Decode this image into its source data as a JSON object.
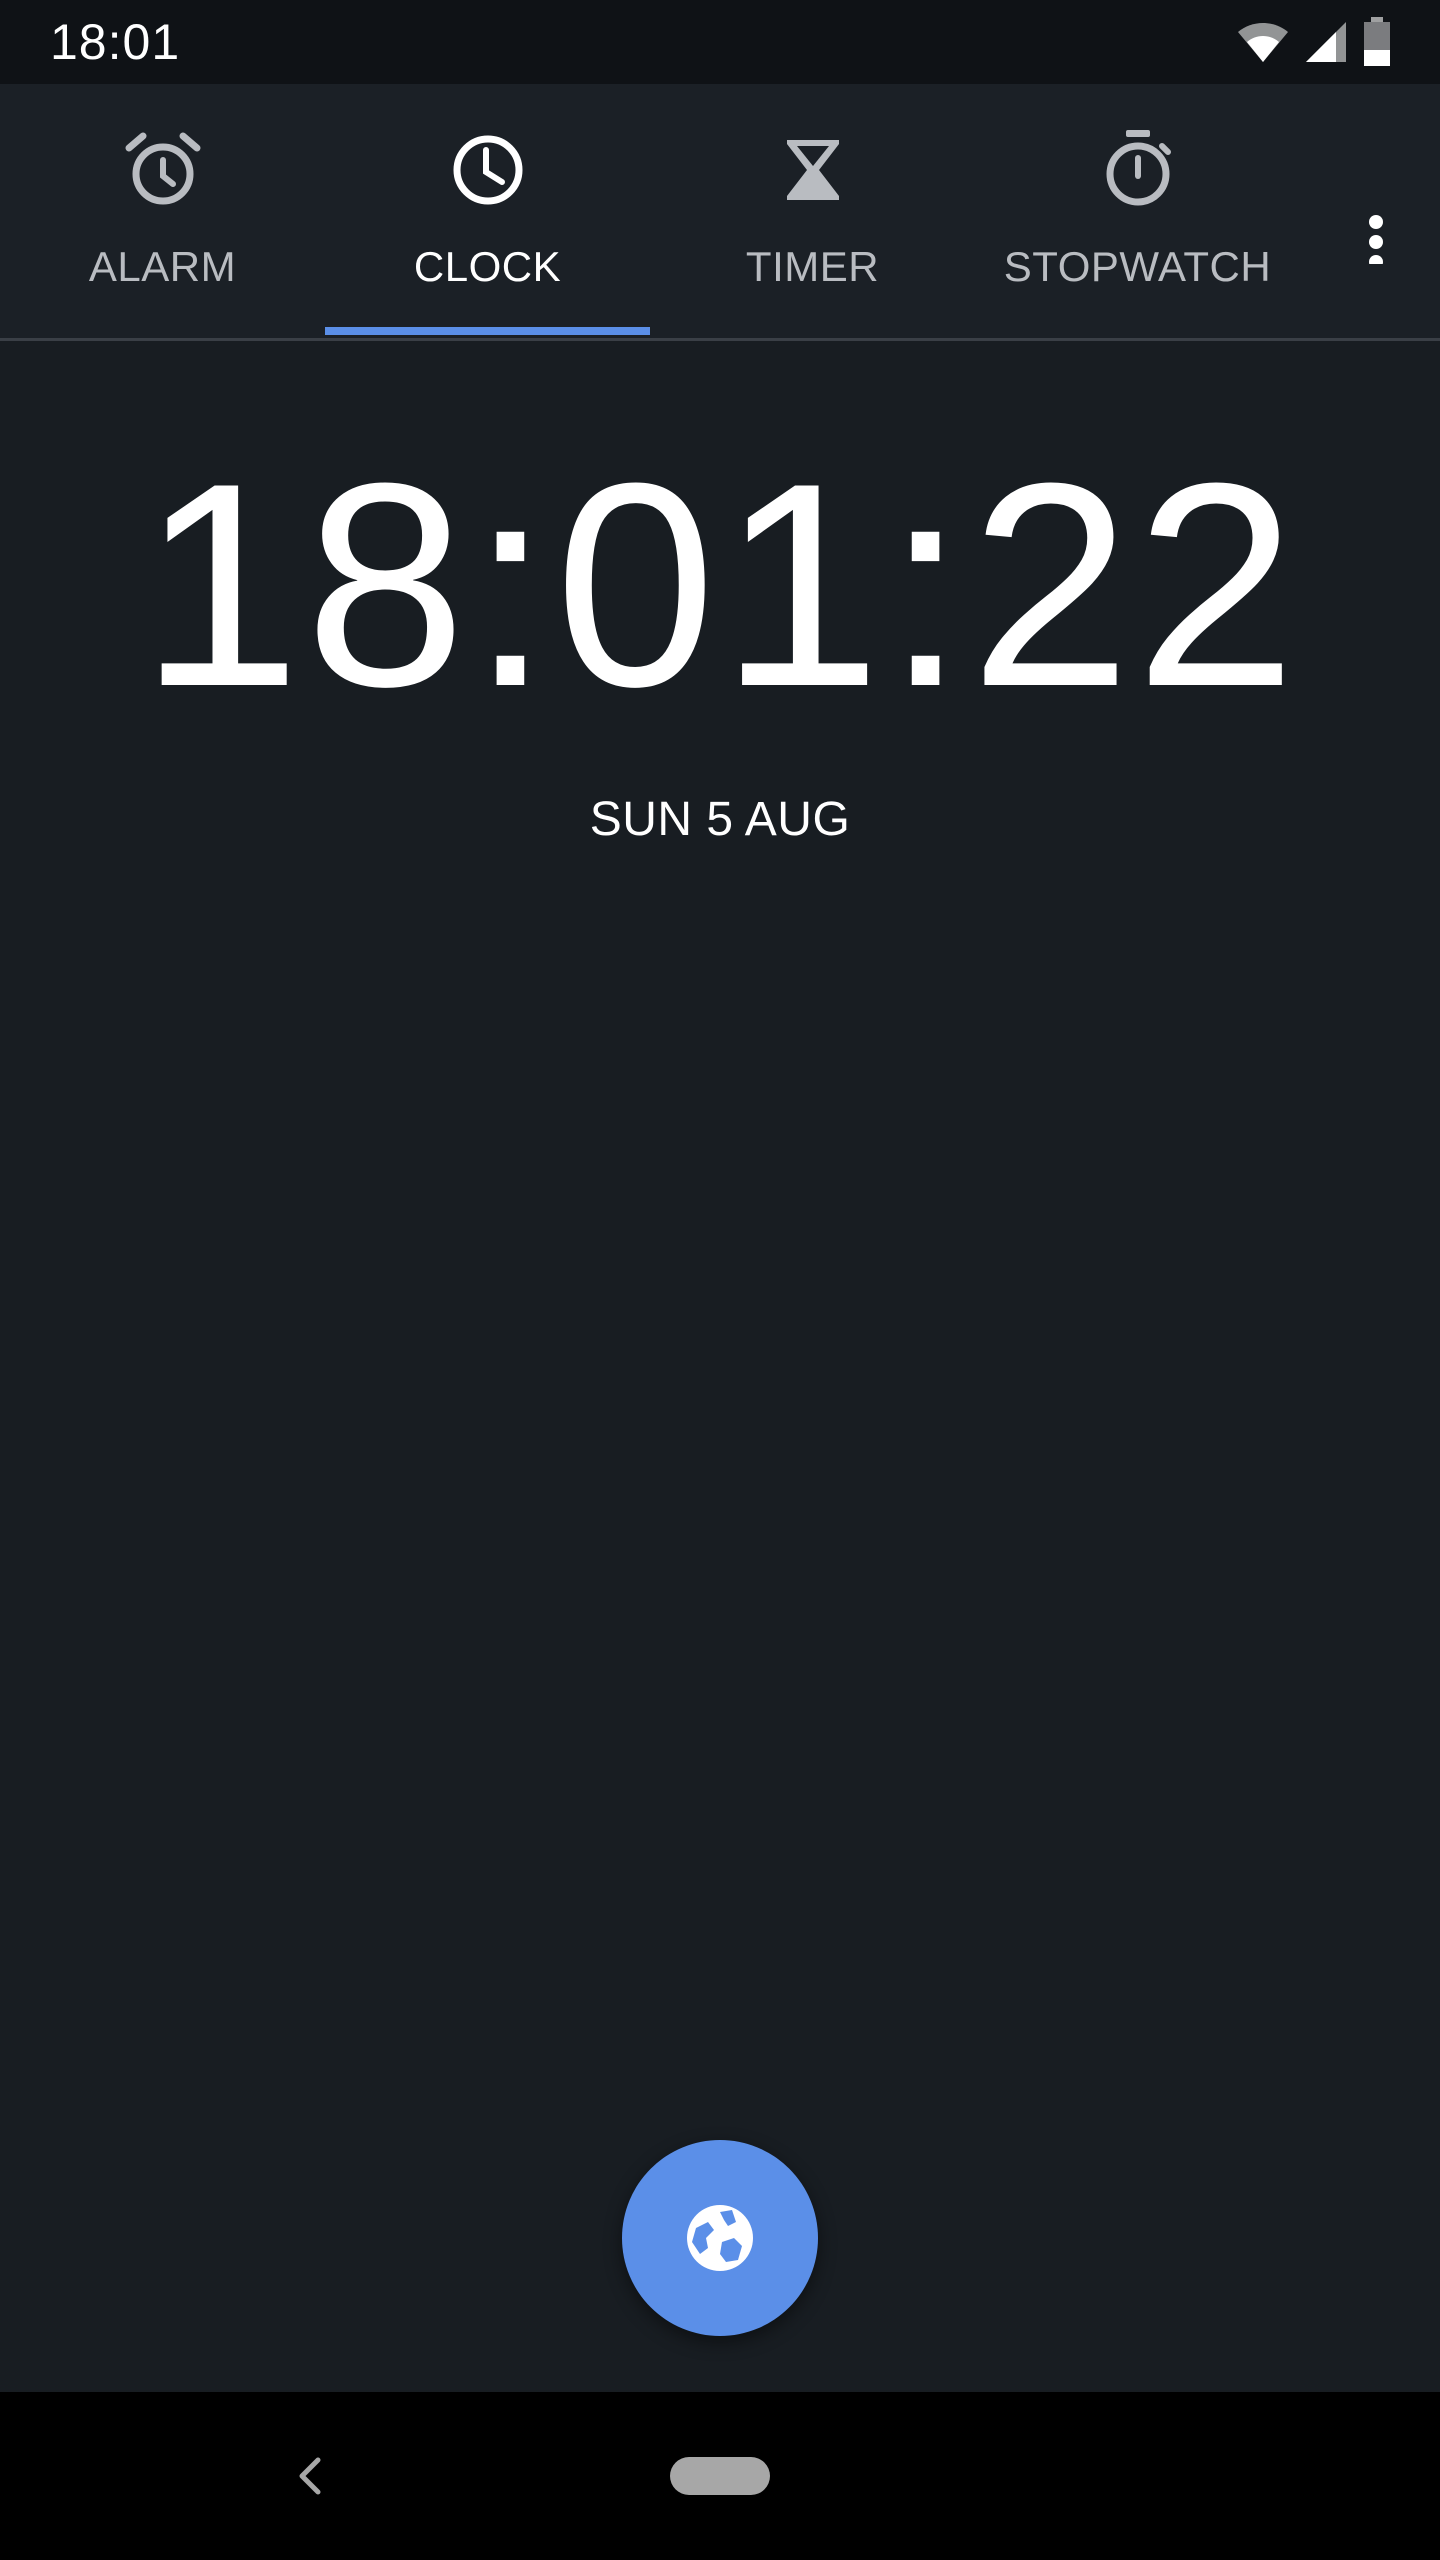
{
  "status_bar": {
    "time": "18:01",
    "icons": [
      "wifi-icon",
      "signal-icon",
      "battery-icon"
    ]
  },
  "tabs": [
    {
      "label": "ALARM",
      "icon": "alarm-clock-icon",
      "active": false
    },
    {
      "label": "CLOCK",
      "icon": "clock-icon",
      "active": true
    },
    {
      "label": "TIMER",
      "icon": "hourglass-icon",
      "active": false
    },
    {
      "label": "STOPWATCH",
      "icon": "stopwatch-icon",
      "active": false
    }
  ],
  "overflow_menu_icon": "more-vert-icon",
  "clock": {
    "time": "18:01:22",
    "date": "SUN 5 AUG"
  },
  "fab": {
    "icon": "globe-icon"
  },
  "navigation_bar": {
    "icons": [
      "back-icon",
      "home-pill-icon"
    ]
  },
  "colors": {
    "background": "#181d22",
    "tab_bar": "#1b2026",
    "status_bar": "#0f1216",
    "accent": "#5b8fe8",
    "inactive_text": "#b9bcc1",
    "active_text": "#ffffff"
  }
}
